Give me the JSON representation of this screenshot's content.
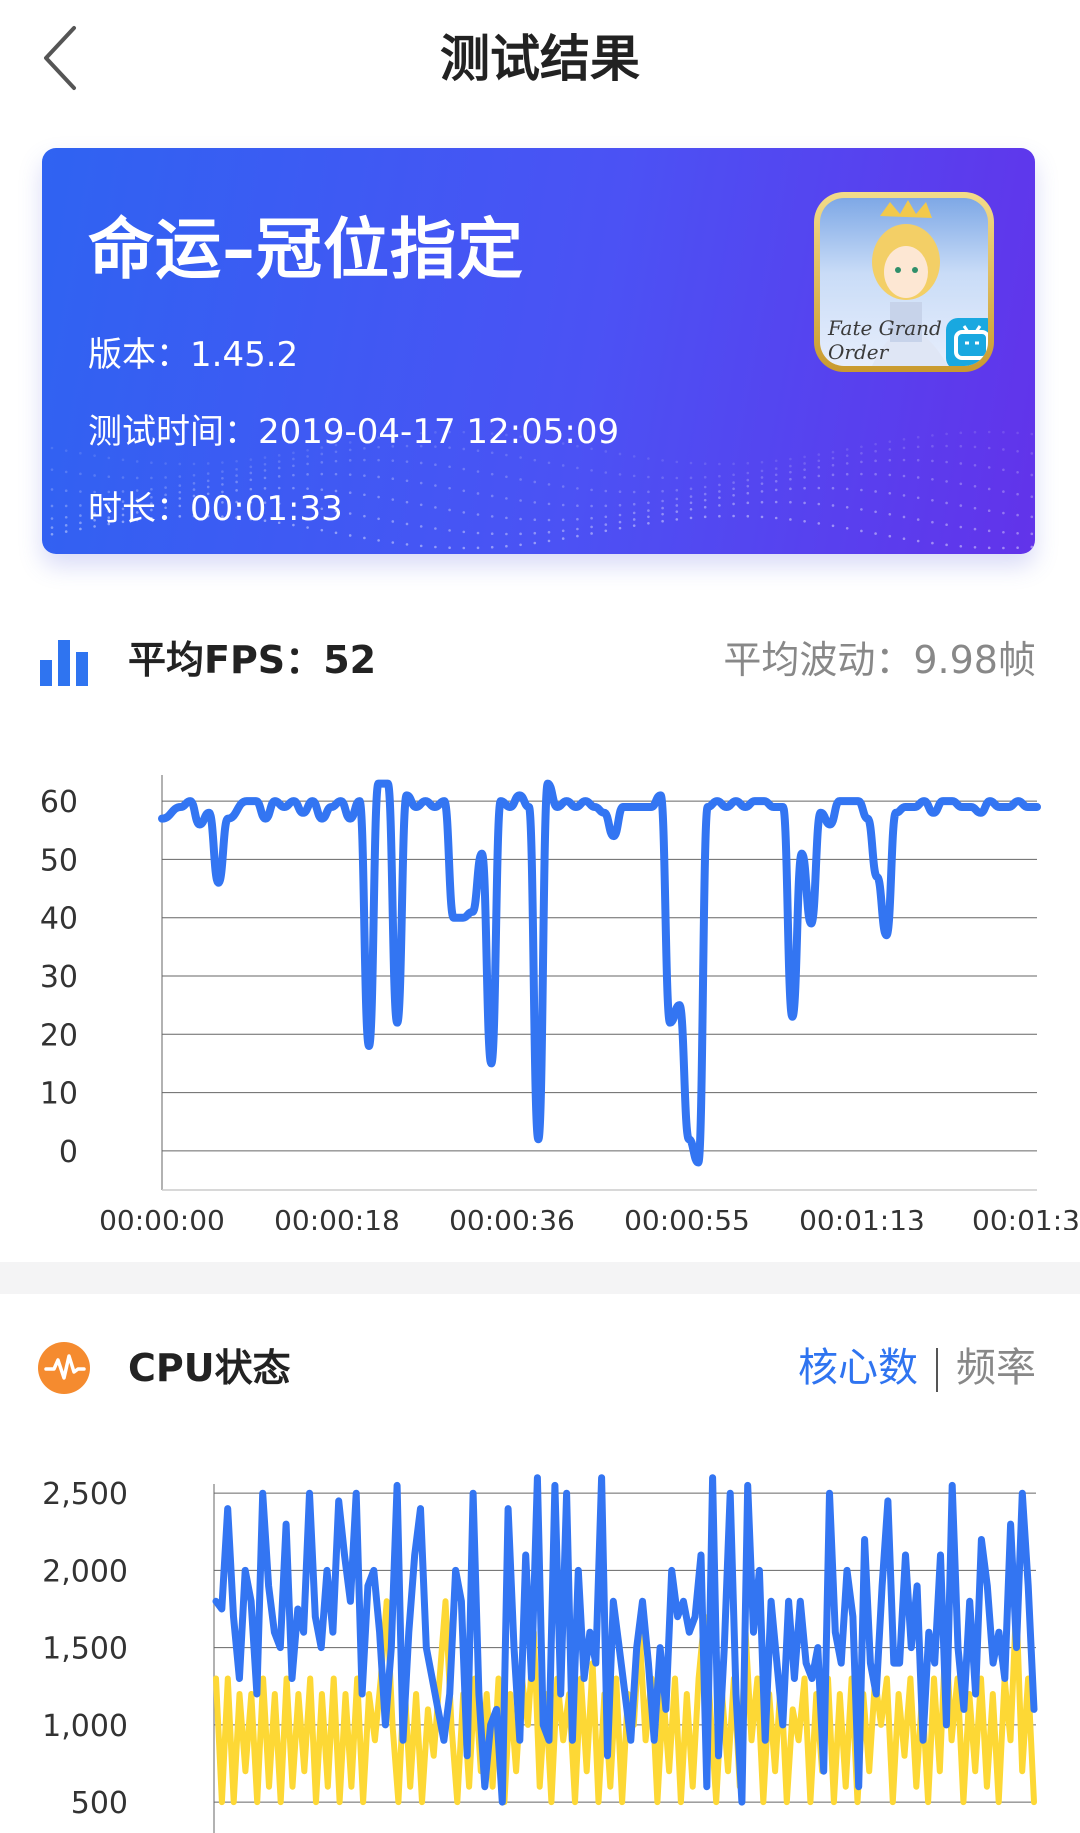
{
  "header": {
    "title": "测试结果"
  },
  "card": {
    "game_name": "命运–冠位指定",
    "version_label": "版本：",
    "version": "1.45.2",
    "test_time_label": "测试时间：",
    "test_time": "2019-04-17 12:05:09",
    "duration_label": "时长：",
    "duration": "00:01:33",
    "icon_brand_text": "Fate Grand Order"
  },
  "fps": {
    "avg_label": "平均FPS：",
    "avg_value": "52",
    "fluct_label": "平均波动：",
    "fluct_value": "9.98帧"
  },
  "cpu": {
    "title": "CPU状态",
    "tabs": [
      "核心数",
      "频率"
    ]
  },
  "colors": {
    "accent": "#2f74f0",
    "line_blue": "#3375f2",
    "line_yellow": "#fdd835",
    "cpu_icon": "#f58b2f"
  },
  "chart_data": [
    {
      "type": "line",
      "title": "",
      "ylim": [
        -5,
        65
      ],
      "yticks": [
        "60",
        "50",
        "40",
        "30",
        "20",
        "10",
        "0"
      ],
      "xtick_labels": [
        "00:00:00",
        "00:00:18",
        "00:00:36",
        "00:00:55",
        "00:01:13",
        "00:01:3"
      ],
      "x_end": 93,
      "series": [
        {
          "points": [
            [
              0,
              57
            ],
            [
              2,
              59
            ],
            [
              3,
              60
            ],
            [
              4,
              56
            ],
            [
              5,
              58
            ],
            [
              6,
              46
            ],
            [
              7,
              57
            ],
            [
              9,
              60
            ],
            [
              10,
              60
            ],
            [
              11,
              57
            ],
            [
              12,
              60
            ],
            [
              13,
              59
            ],
            [
              14,
              60
            ],
            [
              15,
              58
            ],
            [
              16,
              60
            ],
            [
              17,
              57
            ],
            [
              18,
              59
            ],
            [
              19,
              60
            ],
            [
              20,
              57
            ],
            [
              21,
              60
            ],
            [
              22,
              18
            ],
            [
              23,
              63
            ],
            [
              24,
              63
            ],
            [
              25,
              22
            ],
            [
              26,
              61
            ],
            [
              27,
              59
            ],
            [
              28,
              60
            ],
            [
              29,
              59
            ],
            [
              30,
              60
            ],
            [
              31,
              40
            ],
            [
              32,
              40
            ],
            [
              33,
              41
            ],
            [
              34,
              51
            ],
            [
              35,
              15
            ],
            [
              36,
              60
            ],
            [
              37,
              59
            ],
            [
              38,
              61
            ],
            [
              39,
              59
            ],
            [
              40,
              2
            ],
            [
              41,
              63
            ],
            [
              42,
              59
            ],
            [
              43,
              60
            ],
            [
              44,
              59
            ],
            [
              45,
              60
            ],
            [
              46,
              59
            ],
            [
              47,
              58
            ],
            [
              48,
              54
            ],
            [
              49,
              59
            ],
            [
              50,
              59
            ],
            [
              51,
              59
            ],
            [
              52,
              59
            ],
            [
              53,
              61
            ],
            [
              54,
              22
            ],
            [
              55,
              25
            ],
            [
              56,
              2
            ],
            [
              57,
              -2
            ],
            [
              58,
              59
            ],
            [
              59,
              60
            ],
            [
              60,
              59
            ],
            [
              61,
              60
            ],
            [
              62,
              59
            ],
            [
              63,
              60
            ],
            [
              64,
              60
            ],
            [
              65,
              59
            ],
            [
              66,
              59
            ],
            [
              67,
              23
            ],
            [
              68,
              51
            ],
            [
              69,
              39
            ],
            [
              70,
              58
            ],
            [
              71,
              56
            ],
            [
              72,
              60
            ],
            [
              73,
              60
            ],
            [
              74,
              60
            ],
            [
              75,
              57
            ],
            [
              76,
              47
            ],
            [
              77,
              37
            ],
            [
              78,
              58
            ],
            [
              79,
              59
            ],
            [
              80,
              59
            ],
            [
              81,
              60
            ],
            [
              82,
              58
            ],
            [
              83,
              60
            ],
            [
              84,
              60
            ],
            [
              85,
              59
            ],
            [
              86,
              59
            ],
            [
              87,
              58
            ],
            [
              88,
              60
            ],
            [
              89,
              59
            ],
            [
              90,
              59
            ],
            [
              91,
              60
            ],
            [
              92,
              59
            ],
            [
              93,
              59
            ]
          ]
        }
      ]
    },
    {
      "type": "line",
      "title": "",
      "ylim": [
        300,
        2650
      ],
      "yticks": [
        "2,500",
        "2,000",
        "1,500",
        "1,000",
        "500"
      ],
      "ytick_values": [
        2500,
        2000,
        1500,
        1000,
        500
      ],
      "series": [
        {
          "color": "yellow",
          "values": [
            1300,
            500,
            1300,
            500,
            1200,
            700,
            1200,
            500,
            1300,
            600,
            1200,
            500,
            1300,
            600,
            1200,
            700,
            1300,
            500,
            1200,
            600,
            1300,
            500,
            1200,
            600,
            1300,
            500,
            1200,
            900,
            1300,
            1800,
            1000,
            500,
            1300,
            600,
            1200,
            500,
            1100,
            800,
            1300,
            1800,
            1000,
            500,
            1200,
            600,
            1300,
            700,
            1200,
            600,
            1300,
            500,
            1200,
            700,
            1300,
            1000,
            1600,
            600,
            1200,
            500,
            1300,
            900,
            1200,
            500,
            1300,
            700,
            1400,
            500,
            1200,
            600,
            1300,
            500,
            1200,
            1000,
            1600,
            900,
            1300,
            500,
            1200,
            700,
            1300,
            500,
            1200,
            600,
            1300,
            1700,
            1100,
            500,
            1200,
            700,
            1300,
            600,
            1600,
            900,
            1300,
            500,
            1200,
            700,
            1300,
            500,
            1100,
            900,
            1300,
            500,
            1200,
            700,
            1300,
            500,
            1200,
            600,
            1300,
            500,
            1200,
            700,
            1300,
            1000,
            1300,
            500,
            1200,
            800,
            1300,
            600,
            1200,
            500,
            1300,
            700,
            1600,
            900,
            1300,
            500,
            1200,
            700,
            1300,
            600,
            1200,
            500,
            1300,
            900,
            1800,
            700,
            1300,
            500
          ]
        },
        {
          "color": "blue",
          "values": [
            1800,
            1750,
            2400,
            1700,
            1300,
            2000,
            1800,
            1200,
            2500,
            1900,
            1600,
            1500,
            2300,
            1300,
            1750,
            1600,
            2500,
            1700,
            1500,
            2000,
            1600,
            2450,
            2100,
            1800,
            2500,
            1200,
            1900,
            2000,
            1600,
            1000,
            1500,
            2550,
            900,
            1600,
            2100,
            2400,
            1500,
            1300,
            1100,
            900,
            1200,
            2000,
            1800,
            800,
            2500,
            1200,
            600,
            1000,
            1100,
            500,
            2400,
            1500,
            900,
            2100,
            1300,
            2600,
            1000,
            900,
            2550,
            1200,
            2500,
            900,
            2000,
            1300,
            1600,
            1400,
            2600,
            800,
            1800,
            1500,
            1200,
            900,
            1500,
            1800,
            1400,
            900,
            1500,
            1100,
            2000,
            1700,
            1800,
            1600,
            1700,
            2100,
            600,
            2600,
            800,
            1500,
            2500,
            1200,
            500,
            2550,
            1600,
            2000,
            900,
            1800,
            1400,
            1000,
            1800,
            1300,
            1800,
            1400,
            1300,
            1500,
            700,
            2500,
            1600,
            1400,
            2000,
            1700,
            600,
            2200,
            1400,
            1200,
            1900,
            2450,
            1400,
            1400,
            2100,
            1500,
            1900,
            900,
            1600,
            1400,
            2100,
            1000,
            2550,
            1500,
            1100,
            1800,
            1200,
            2200,
            1900,
            1400,
            1600,
            1300,
            2300,
            1500,
            2500,
            1900,
            1100
          ]
        }
      ]
    }
  ]
}
